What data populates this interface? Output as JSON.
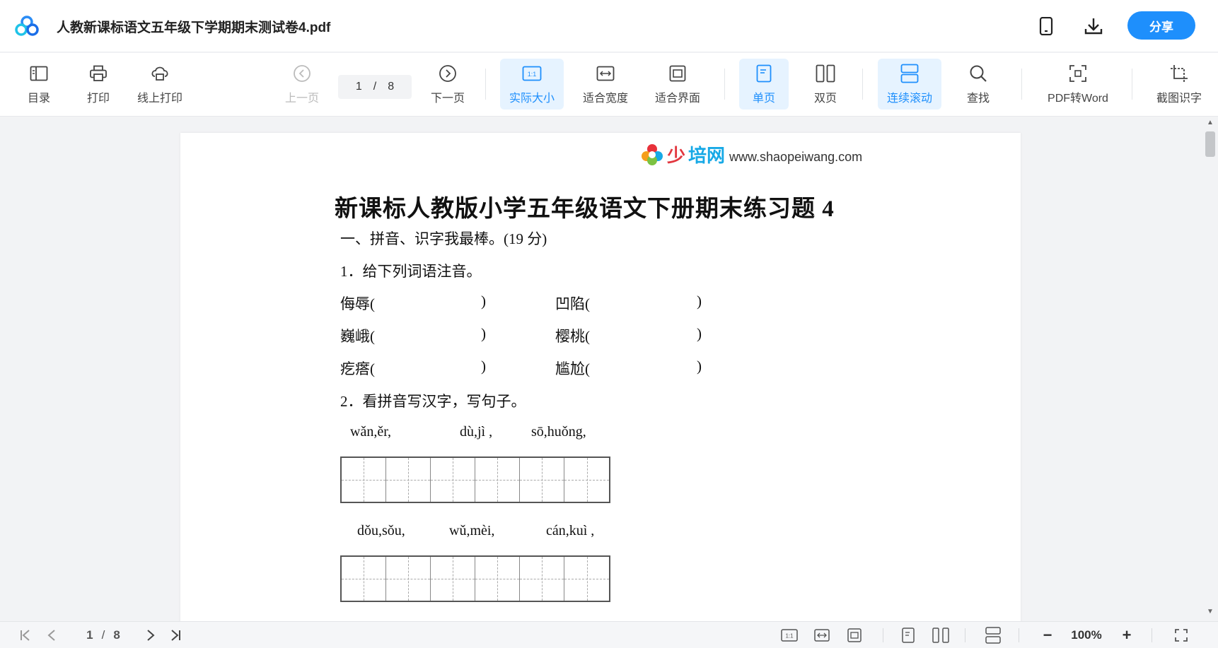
{
  "header": {
    "title": "人教新课标语文五年级下学期期末测试卷4.pdf",
    "share_label": "分享",
    "icons": [
      "app-logo-icon",
      "phone-icon",
      "download-icon"
    ]
  },
  "toolbar": {
    "toc": "目录",
    "print": "打印",
    "online_print": "线上打印",
    "prev_page": "上一页",
    "current_page": "1",
    "page_sep": "/",
    "total_pages": "8",
    "next_page": "下一页",
    "actual_size": "实际大小",
    "fit_width": "适合宽度",
    "fit_screen": "适合界面",
    "single_page": "单页",
    "double_page": "双页",
    "continuous_scroll": "连续滚动",
    "find": "查找",
    "pdf_to_word": "PDF转Word",
    "ocr": "截图识字",
    "accent_color": "#1e8ffc"
  },
  "document": {
    "watermark_brand_1": "少",
    "watermark_brand_2": "培网",
    "watermark_site": "www.shaopeiwang.com",
    "title": "新课标人教版小学五年级语文下册期末练习题 4",
    "section1": "一、拼音、识字我最棒。(19 分)",
    "q1": "1．给下列词语注音。",
    "words": [
      {
        "w": "侮辱(",
        "close": ")"
      },
      {
        "w": "凹陷(",
        "close": ")"
      },
      {
        "w": "巍峨(",
        "close": ")"
      },
      {
        "w": "樱桃(",
        "close": ")"
      },
      {
        "w": "疙瘩(",
        "close": ")"
      },
      {
        "w": "尴尬(",
        "close": ")"
      }
    ],
    "q2": "2．看拼音写汉字，写句子。",
    "pinyin_row1": [
      "wǎn,ěr,",
      "dù,jì ,",
      "sō,huǒng,"
    ],
    "pinyin_row2": [
      "dǒu,sǒu,",
      "wǔ,mèi,",
      "cán,kuì ,"
    ]
  },
  "bottombar": {
    "current_page": "1",
    "page_sep": "/",
    "total_pages": "8",
    "zoom": "100%",
    "minus": "−",
    "plus": "+"
  }
}
